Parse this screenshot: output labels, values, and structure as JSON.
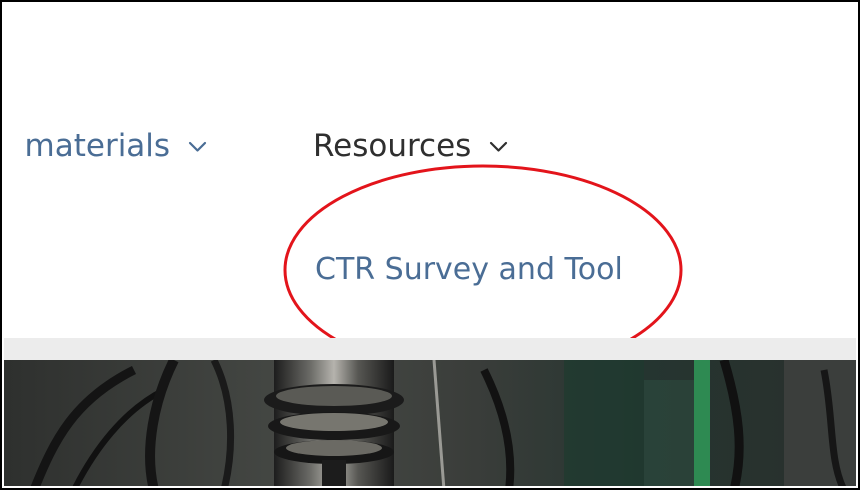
{
  "nav": {
    "partial_item_label": "g materials",
    "resources_label": "Resources"
  },
  "submenu": {
    "link_label": "CTR Survey and Tool"
  },
  "colors": {
    "link": "#4a6d95",
    "nav_text": "#2f2f2f",
    "highlight": "#e3141b",
    "divider": "#ececec"
  },
  "icons": {
    "dropdown": "chevron-down-icon"
  }
}
